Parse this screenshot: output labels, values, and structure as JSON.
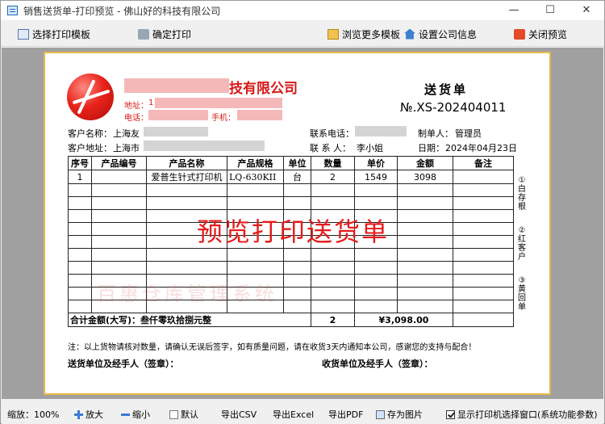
{
  "window": {
    "title": "销售送货单-打印预览 - 佛山好的科技有限公司",
    "minimize": "—",
    "maximize": "☐",
    "close": "✕"
  },
  "toolbar": {
    "select_template": "选择打印模板",
    "confirm_print": "确定打印",
    "browse_templates": "浏览更多模板",
    "set_company": "设置公司信息",
    "close_preview": "关闭预览"
  },
  "document": {
    "company_suffix": "技有限公司",
    "address_label": "地址：",
    "address_value": "1",
    "phone_label": "电话：",
    "mobile_label": "手机：",
    "title": "送货单",
    "number": "№.XS-202404011",
    "customer_name_label": "客户名称：",
    "customer_name_value": "上海友",
    "customer_phone_label": "联系电话：",
    "maker_label": "制单人：",
    "maker_value": "管理员",
    "customer_addr_label": "客户地址：",
    "customer_addr_value": "上海市",
    "contact_label": "联 系 人：",
    "contact_value": "李小姐",
    "date_label": "日期：",
    "date_value": "2024年04月23日",
    "columns": [
      "序号",
      "产品编号",
      "产品名称",
      "产品规格",
      "单位",
      "数量",
      "单价",
      "金额",
      "备注"
    ],
    "rows": [
      [
        "1",
        "",
        "爱普生针式打印机",
        "LQ-630KII",
        "台",
        "2",
        "1549",
        "3098",
        ""
      ]
    ],
    "total_label": "合计金额(大写)：叁仟零玖拾捌元整",
    "total_qty": "2",
    "total_amount": "¥3,098.00",
    "note": "注：以上货物请核对数量，请确认无误后签字，如有质量问题，请在收货3天内通知本公司，感谢您的支持与配合！",
    "sender_sign": "送货单位及经手人（签章）：",
    "receiver_sign": "收货单位及经手人（签章）：",
    "copy1": "①白存根",
    "copy2": "②红客户",
    "copy3": "③黄回单",
    "watermark": "预览打印送货单",
    "watermark2": "百惠仓库管理系统"
  },
  "statusbar": {
    "zoom_label": "缩放：100%",
    "zoom_in": "放大",
    "zoom_out": "缩小",
    "default": "默认",
    "export_csv": "导出CSV",
    "export_excel": "导出Excel",
    "export_pdf": "导出PDF",
    "save_image": "存为图片",
    "show_printer_dialog": "显示打印机选择窗口(系统功能参数)"
  }
}
